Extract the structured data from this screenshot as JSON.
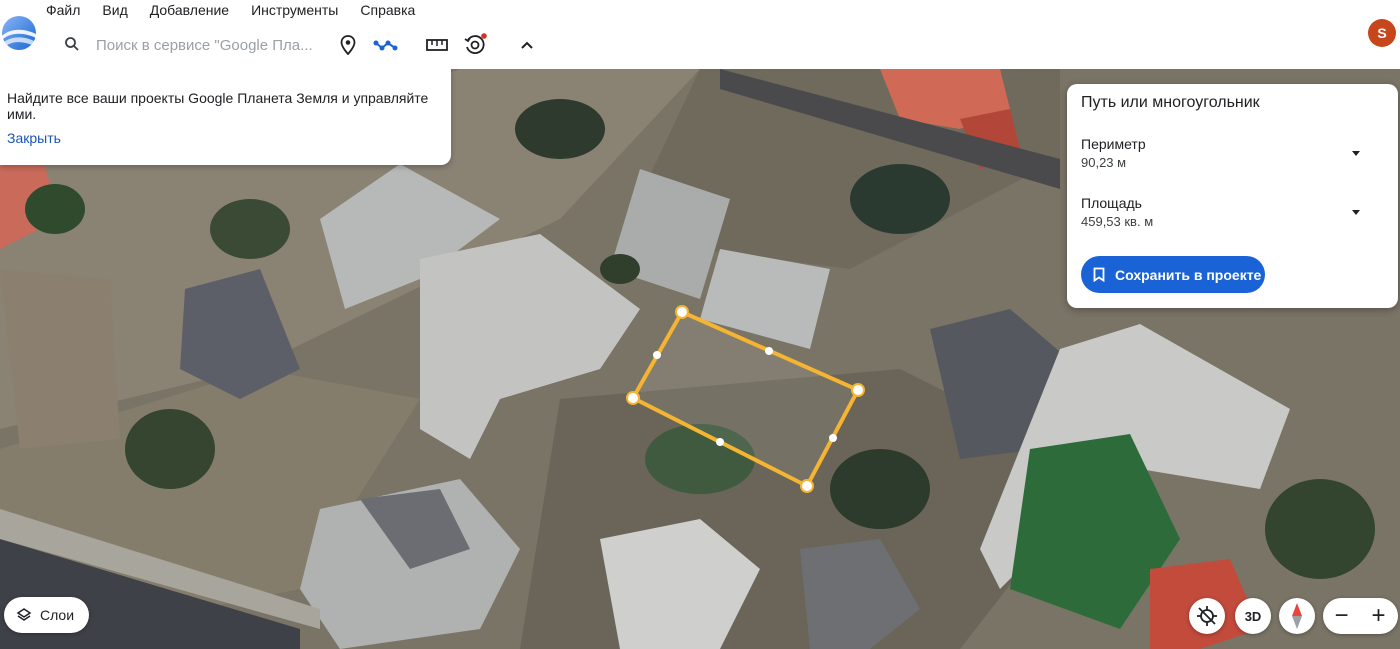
{
  "menu": [
    "Файл",
    "Вид",
    "Добавление",
    "Инструменты",
    "Справка"
  ],
  "search": {
    "placeholder": "Поиск в сервисе \"Google Пла..."
  },
  "toolbar": {
    "icons": [
      "search-icon",
      "placemark-icon",
      "path-icon",
      "ruler-icon",
      "history-icon",
      "chevron-up-icon"
    ],
    "notification_dot_color": "#d93025"
  },
  "user": {
    "avatar_initial": "S",
    "avatar_color": "#c8461c"
  },
  "tip": {
    "text": "Найдите все ваши проекты Google Планета Земля и управляйте ими.",
    "close_label": "Закрыть"
  },
  "measure_panel": {
    "title": "Путь или многоугольник",
    "perimeter_label": "Периметр",
    "perimeter_value": "90,23 м",
    "area_label": "Площадь",
    "area_value": "459,53 кв. м",
    "save_label": "Сохранить в проекте",
    "accent_color": "#1a63d6"
  },
  "polygon": {
    "stroke_color": "#f5b431"
  },
  "controls": {
    "layers_label": "Слои",
    "btn_3d_label": "3D",
    "zoom_out_label": "−",
    "zoom_in_label": "+"
  }
}
